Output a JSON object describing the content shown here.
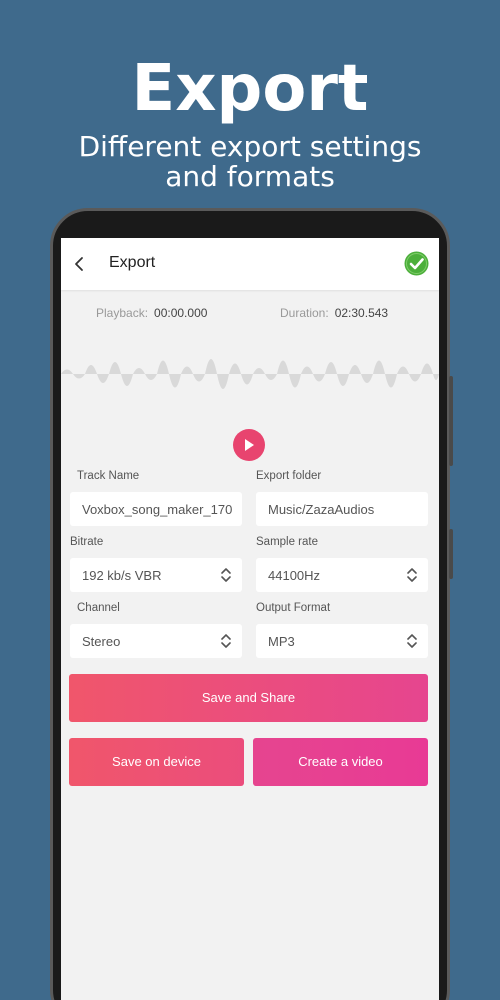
{
  "promo": {
    "title": "Export",
    "subtitle": "Different export settings and formats"
  },
  "header": {
    "title": "Export",
    "back_icon": "chevron-left-icon",
    "done_icon": "check-circle-icon",
    "done_color": "#4caf3b"
  },
  "timing": {
    "playback_label": "Playback:",
    "playback_value": "00:00.000",
    "duration_label": "Duration:",
    "duration_value": "02:30.543"
  },
  "player": {
    "play_icon": "play-icon",
    "accent": "#e8446f"
  },
  "form": {
    "track_name_label": "Track Name",
    "track_name_value": "Voxbox_song_maker_170",
    "export_folder_label": "Export folder",
    "export_folder_value": "Music/ZazaAudios",
    "bitrate_label": "Bitrate",
    "bitrate_value": "192 kb/s VBR",
    "sample_rate_label": "Sample rate",
    "sample_rate_value": "44100Hz",
    "channel_label": "Channel",
    "channel_value": "Stereo",
    "output_format_label": "Output Format",
    "output_format_value": "MP3"
  },
  "actions": {
    "save_share": "Save and Share",
    "save_device": "Save on device",
    "create_video": "Create a video"
  },
  "colors": {
    "background": "#3f6a8c",
    "gradient_start": "#f0566b",
    "gradient_end": "#e6458f"
  }
}
